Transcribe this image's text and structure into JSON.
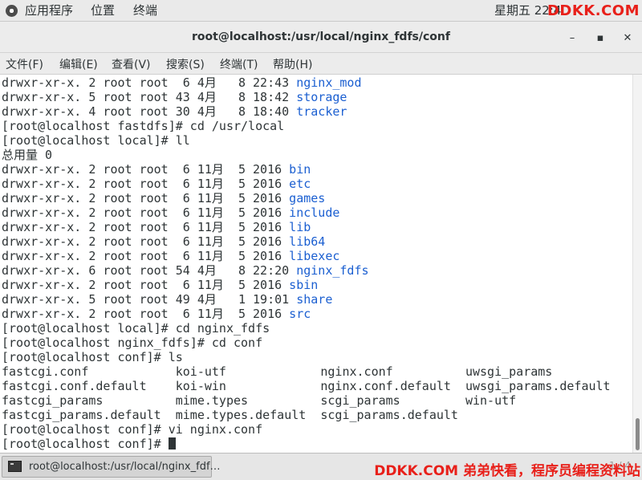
{
  "top_panel": {
    "apps": "应用程序",
    "places": "位置",
    "terminal": "终端",
    "clock": "星期五 22:4",
    "watermark": "DDKK.COM"
  },
  "window": {
    "title": "root@localhost:/usr/local/nginx_fdfs/conf",
    "minimize": "–",
    "maximize": "▪",
    "close": "✕"
  },
  "menubar": [
    "文件(F)",
    "编辑(E)",
    "查看(V)",
    "搜索(S)",
    "终端(T)",
    "帮助(H)"
  ],
  "terminal": {
    "lines": [
      {
        "text": "drwxr-xr-x. 2 root root  6 4月   8 22:43 ",
        "dir": "nginx_mod"
      },
      {
        "text": "drwxr-xr-x. 5 root root 43 4月   8 18:42 ",
        "dir": "storage"
      },
      {
        "text": "drwxr-xr-x. 4 root root 30 4月   8 18:40 ",
        "dir": "tracker"
      },
      {
        "text": "[root@localhost fastdfs]# cd /usr/local",
        "dir": ""
      },
      {
        "text": "[root@localhost local]# ll",
        "dir": ""
      },
      {
        "text": "总用量 0",
        "dir": ""
      },
      {
        "text": "drwxr-xr-x. 2 root root  6 11月  5 2016 ",
        "dir": "bin"
      },
      {
        "text": "drwxr-xr-x. 2 root root  6 11月  5 2016 ",
        "dir": "etc"
      },
      {
        "text": "drwxr-xr-x. 2 root root  6 11月  5 2016 ",
        "dir": "games"
      },
      {
        "text": "drwxr-xr-x. 2 root root  6 11月  5 2016 ",
        "dir": "include"
      },
      {
        "text": "drwxr-xr-x. 2 root root  6 11月  5 2016 ",
        "dir": "lib"
      },
      {
        "text": "drwxr-xr-x. 2 root root  6 11月  5 2016 ",
        "dir": "lib64"
      },
      {
        "text": "drwxr-xr-x. 2 root root  6 11月  5 2016 ",
        "dir": "libexec"
      },
      {
        "text": "drwxr-xr-x. 6 root root 54 4月   8 22:20 ",
        "dir": "nginx_fdfs"
      },
      {
        "text": "drwxr-xr-x. 2 root root  6 11月  5 2016 ",
        "dir": "sbin"
      },
      {
        "text": "drwxr-xr-x. 5 root root 49 4月   1 19:01 ",
        "dir": "share"
      },
      {
        "text": "drwxr-xr-x. 2 root root  6 11月  5 2016 ",
        "dir": "src"
      },
      {
        "text": "[root@localhost local]# cd nginx_fdfs",
        "dir": ""
      },
      {
        "text": "[root@localhost nginx_fdfs]# cd conf",
        "dir": ""
      },
      {
        "text": "[root@localhost conf]# ls",
        "dir": ""
      },
      {
        "text": "fastcgi.conf            koi-utf             nginx.conf          uwsgi_params",
        "dir": ""
      },
      {
        "text": "fastcgi.conf.default    koi-win             nginx.conf.default  uwsgi_params.default",
        "dir": ""
      },
      {
        "text": "fastcgi_params          mime.types          scgi_params         win-utf",
        "dir": ""
      },
      {
        "text": "fastcgi_params.default  mime.types.default  scgi_params.default",
        "dir": ""
      },
      {
        "text": "[root@localhost conf]# vi nginx.conf",
        "dir": ""
      },
      {
        "text": "[root@localhost conf]# ",
        "dir": ""
      }
    ]
  },
  "taskbar": {
    "task_label": "root@localhost:/usr/local/nginx_fdf…",
    "pager": "1 / 4",
    "watermark": "DDKK.COM 弟弟快看，程序员编程资料站"
  },
  "colors": {
    "directory": "#1b5fd1",
    "watermark": "#e8201a",
    "text": "#2e3436"
  },
  "icons": [
    "apps-menu-icon",
    "minimize-icon",
    "maximize-icon",
    "close-icon",
    "terminal-app-icon"
  ]
}
